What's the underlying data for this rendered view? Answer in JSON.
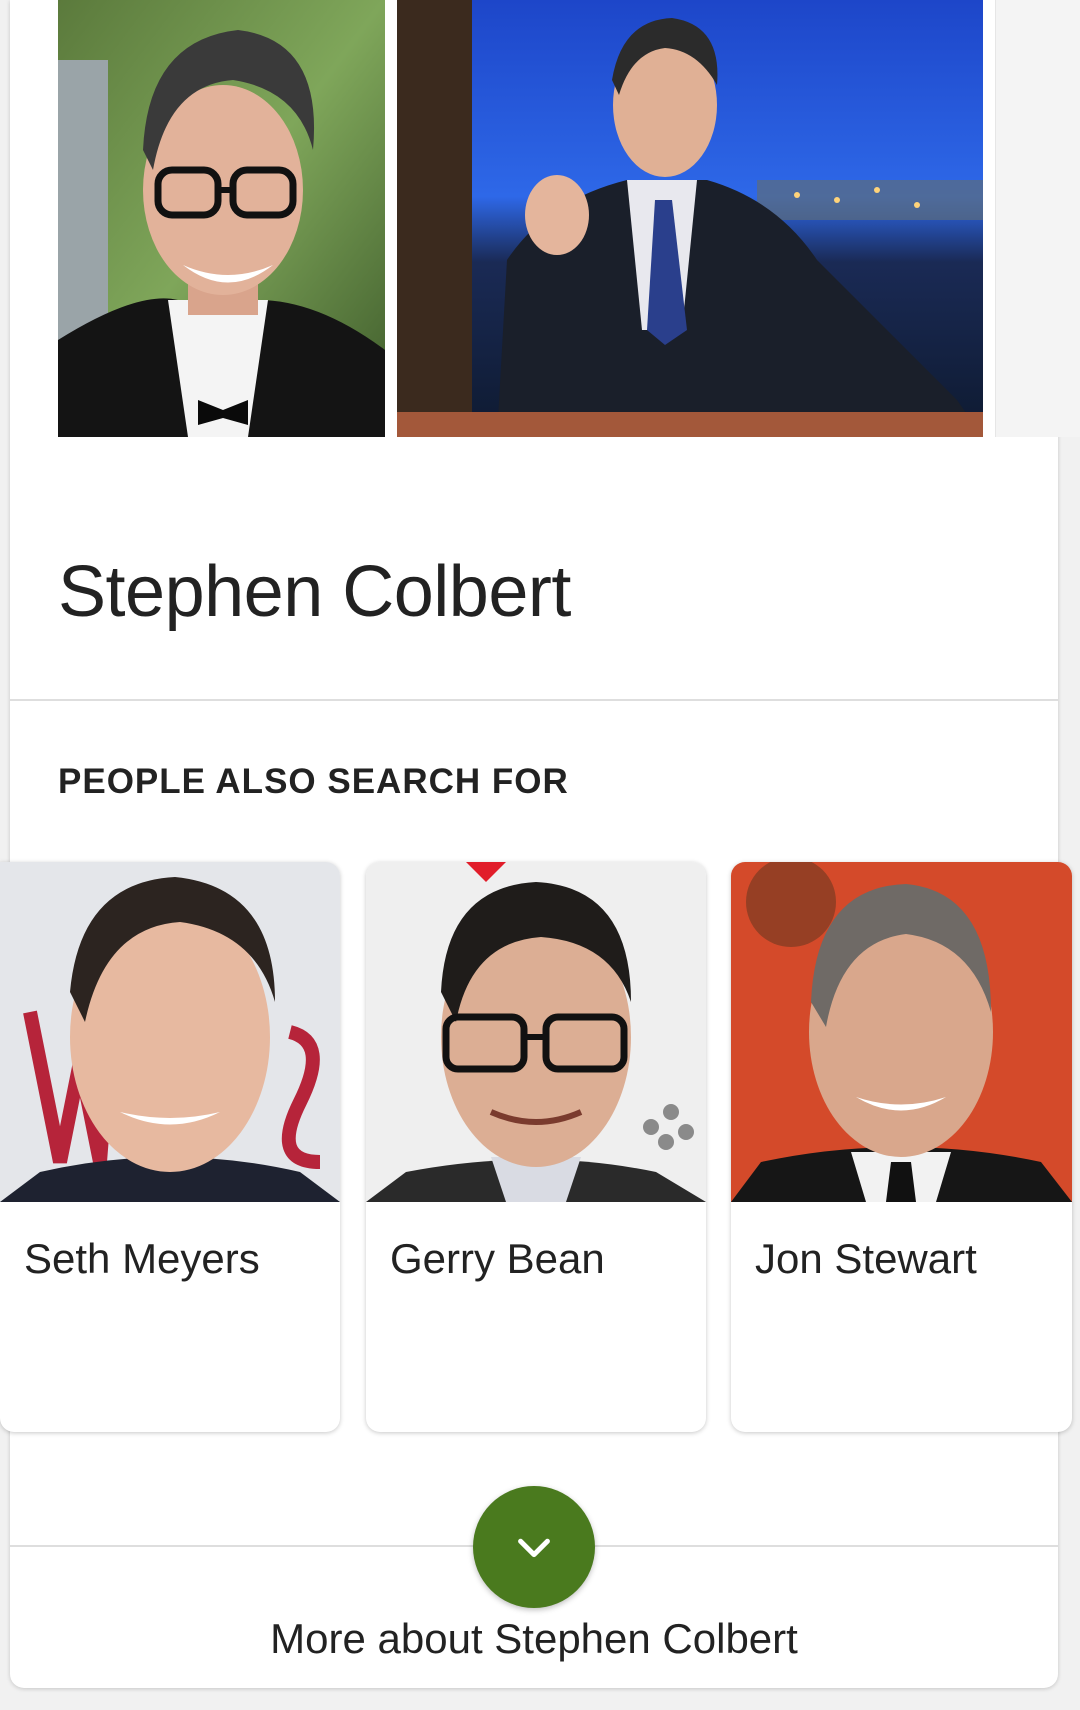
{
  "entity": {
    "title": "Stephen Colbert"
  },
  "related": {
    "heading": "PEOPLE ALSO SEARCH FOR",
    "people": [
      {
        "name": "Seth Meyers"
      },
      {
        "name": "Gerry Bean"
      },
      {
        "name": "Jon Stewart"
      }
    ]
  },
  "footer": {
    "more_label": "More about Stephen Colbert",
    "expand_icon": "chevron-down-icon"
  },
  "colors": {
    "accent_green": "#4a7a1e",
    "text": "#222222",
    "divider": "#dedede"
  }
}
